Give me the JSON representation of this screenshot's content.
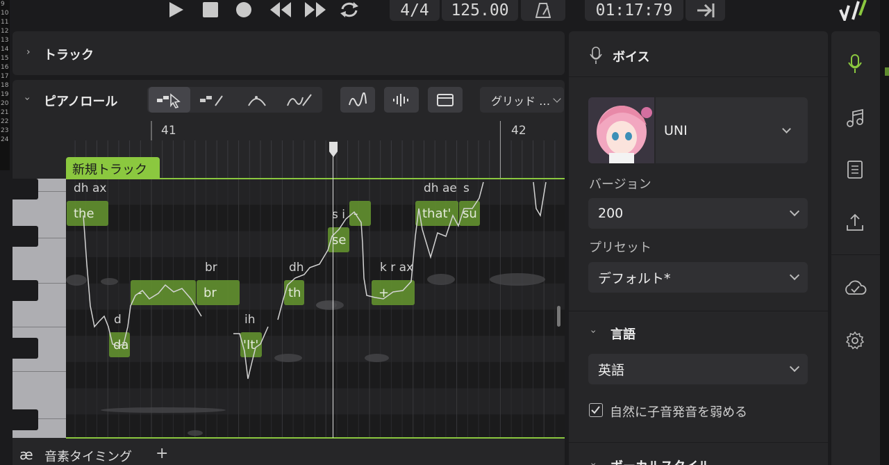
{
  "transport": {
    "time_signature": "4/4",
    "tempo": "125.00",
    "time": "01:17:79",
    "icons": [
      "play-icon",
      "stop-icon",
      "record-icon",
      "rewind-icon",
      "fast-forward-icon",
      "loop-icon",
      "metronome-icon",
      "follow-playhead-icon"
    ]
  },
  "tracks_panel": {
    "title": "トラック"
  },
  "piano_roll": {
    "title": "ピアノロール",
    "grid_label": "グリッド …",
    "bars": [
      "41",
      "42"
    ],
    "track_name": "新規トラック",
    "notes": [
      {
        "text": "the",
        "phoneme": "dh ax"
      },
      {
        "text": "da",
        "phoneme": "d"
      },
      {
        "text": "-",
        "phoneme": ""
      },
      {
        "text": "br",
        "phoneme": "br"
      },
      {
        "text": "'It'",
        "phoneme": "ih"
      },
      {
        "text": "th",
        "phoneme": "dh"
      },
      {
        "text": "se",
        "phoneme": "s i"
      },
      {
        "text": "-",
        "phoneme": ""
      },
      {
        "text": "+",
        "phoneme": "k r ax"
      },
      {
        "text": "that'",
        "phoneme": "dh ae"
      },
      {
        "text": "su",
        "phoneme": "s"
      }
    ]
  },
  "bottom_tab": {
    "icon_text": "æ",
    "label": "音素タイミング",
    "add": "+"
  },
  "voice_panel": {
    "title": "ボイス",
    "voice_name": "UNI",
    "version_label": "バージョン",
    "version_value": "200",
    "preset_label": "プリセット",
    "preset_value": "デフォルト*",
    "language_section": "言語",
    "language_value": "英語",
    "checkbox_label": "自然に子音発音を弱める",
    "checkbox_checked": true,
    "next_section": "ボーカルスタイル"
  },
  "sidebar": {
    "icons": [
      "microphone-icon",
      "music-note-icon",
      "book-icon",
      "upload-icon",
      "cloud-icon",
      "settings-icon"
    ],
    "active": "microphone-icon",
    "accent": "#8bc83f"
  },
  "left_ruler_digits": [
    "9",
    "10",
    "11",
    "12",
    "13",
    "14",
    "15",
    "16",
    "17",
    "18",
    "19",
    "20",
    "21",
    "22",
    "23",
    "24"
  ]
}
